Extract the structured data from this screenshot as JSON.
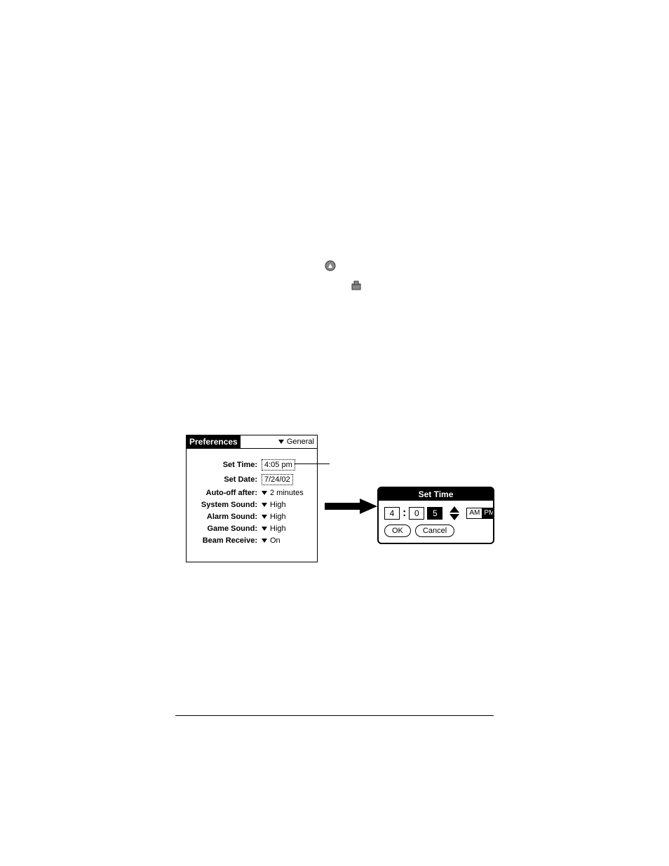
{
  "icons": {
    "applications": "applications-icon",
    "prefs": "prefs-icon"
  },
  "prefs_panel": {
    "title": "Preferences",
    "category": "General",
    "rows": {
      "set_time": {
        "label": "Set Time:",
        "value": "4:05 pm"
      },
      "set_date": {
        "label": "Set Date:",
        "value": "7/24/02"
      },
      "auto_off": {
        "label": "Auto-off after:",
        "value": "2 minutes"
      },
      "sys_sound": {
        "label": "System Sound:",
        "value": "High"
      },
      "alarm_sound": {
        "label": "Alarm Sound:",
        "value": "High"
      },
      "game_sound": {
        "label": "Game Sound:",
        "value": "High"
      },
      "beam": {
        "label": "Beam Receive:",
        "value": "On"
      }
    }
  },
  "set_time_dialog": {
    "title": "Set Time",
    "hour": "4",
    "min_tens": "0",
    "min_ones": "5",
    "am": "AM",
    "pm": "PM",
    "ok": "OK",
    "cancel": "Cancel"
  }
}
